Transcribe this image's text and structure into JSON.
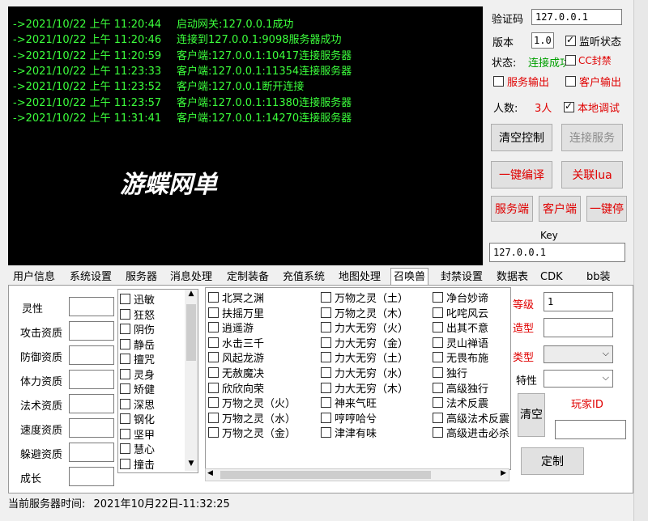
{
  "console": {
    "lines": [
      {
        "time": "->2021/10/22 上午 11:20:44",
        "msg": "启动网关:127.0.0.1成功"
      },
      {
        "time": "->2021/10/22 上午 11:20:46",
        "msg": "连接到127.0.0.1:9098服务器成功"
      },
      {
        "time": "->2021/10/22 上午 11:20:59",
        "msg": "客户端:127.0.0.1:10417连接服务器"
      },
      {
        "time": "->2021/10/22 上午 11:23:33",
        "msg": "客户端:127.0.0.1:11354连接服务器"
      },
      {
        "time": "->2021/10/22 上午 11:23:52",
        "msg": "客户端:127.0.0.1断开连接"
      },
      {
        "time": "->2021/10/22 上午 11:23:57",
        "msg": "客户端:127.0.0.1:11380连接服务器"
      },
      {
        "time": "->2021/10/22 上午 11:31:41",
        "msg": "客户端:127.0.0.1:14270连接服务器"
      }
    ],
    "title": "游蝶网单"
  },
  "right_panel": {
    "verify_label": "验证码",
    "verify_value": "127.0.0.1",
    "version_label": "版本",
    "version_value": "1.0",
    "listen_label": "监听状态",
    "status_label": "状态:",
    "status_value": "连接成功",
    "cc_label": "CC封禁",
    "service_output": "服务输出",
    "client_output": "客户输出",
    "people_label": "人数:",
    "people_value": "3人",
    "local_debug": "本地调试",
    "clear_btn": "清空控制",
    "connect_btn": "连接服务",
    "compile_btn": "一键编译",
    "lua_btn": "关联lua",
    "server_btn": "服务端",
    "client_btn": "客户端",
    "stop_btn": "一键停",
    "key_label": "Key",
    "key_value": "127.0.0.1"
  },
  "tabs": [
    "用户信息",
    "系统设置",
    "服务器",
    "消息处理",
    "定制装备",
    "充值系统",
    "地图处理",
    "召唤兽",
    "封禁设置",
    "数据表",
    "CDK",
    "bb装"
  ],
  "active_tab": "召唤兽",
  "attributes": [
    "灵性",
    "攻击资质",
    "防御资质",
    "体力资质",
    "法术资质",
    "速度资质",
    "躲避资质",
    "成长"
  ],
  "skill_list_small": [
    "迅敏",
    "狂怒",
    "阴伤",
    "静岳",
    "擅咒",
    "灵身",
    "矫健",
    "深思",
    "钢化",
    "坚甲",
    "慧心",
    "撞击"
  ],
  "skills_col1": [
    "北冥之渊",
    "扶摇万里",
    "逍遥游",
    "水击三千",
    "风起龙游",
    "无赦魔决",
    "欣欣向荣",
    "万物之灵（火）",
    "万物之灵（水）",
    "万物之灵（金）"
  ],
  "skills_col2": [
    "万物之灵（土）",
    "万物之灵（木）",
    "力大无穷（火）",
    "力大无穷（金）",
    "力大无穷（土）",
    "力大无穷（水）",
    "力大无穷（木）",
    "神来气旺",
    "哼哼哈兮",
    "津津有味"
  ],
  "skills_col3": [
    "净台妙谛",
    "叱咤风云",
    "出其不意",
    "灵山禅语",
    "无畏布施",
    "独行",
    "高级独行",
    "法术反震",
    "高级法术反震",
    "高级进击必杀"
  ],
  "custom_panel": {
    "level_label": "等级",
    "level_value": "1",
    "model_label": "造型",
    "type_label": "类型",
    "trait_label": "特性",
    "player_id_label": "玩家ID",
    "clear_btn": "清空",
    "custom_btn": "定制"
  },
  "statusbar": {
    "label": "当前服务器时间:",
    "value": "2021年10月22日-11:32:25"
  }
}
